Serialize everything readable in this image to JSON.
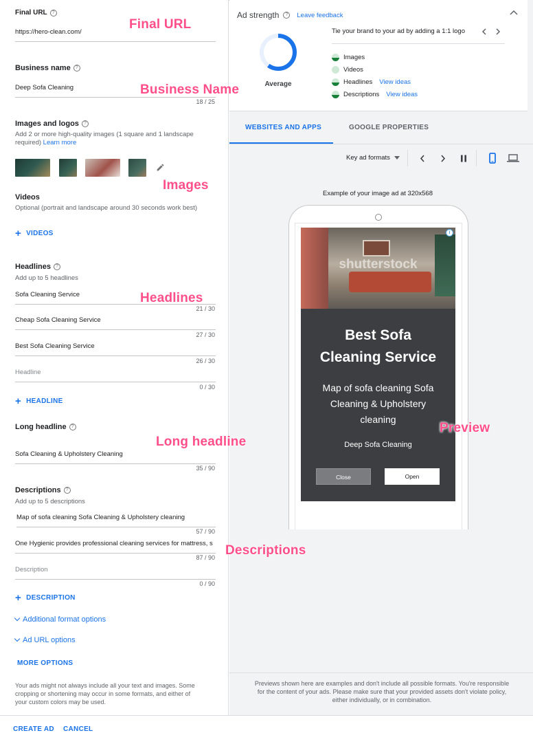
{
  "form": {
    "final_url": {
      "label": "Final URL",
      "value": "https://hero-clean.com/"
    },
    "business_name": {
      "label": "Business name",
      "value": "Deep Sofa Cleaning",
      "counter": "18 / 25"
    },
    "images": {
      "label": "Images and logos",
      "hint_line1": "Add 2 or more high-quality images (1 square and 1 landscape",
      "hint_line2": "required)",
      "learn_more": "Learn more"
    },
    "videos": {
      "label": "Videos",
      "hint": "Optional (portrait and landscape around 30 seconds work best)",
      "add_label": "VIDEOS"
    },
    "headlines": {
      "label": "Headlines",
      "hint": "Add up to 5 headlines",
      "items": [
        {
          "value": "Sofa Cleaning Service",
          "counter": "21 / 30"
        },
        {
          "value": "Cheap Sofa Cleaning Service",
          "counter": "27 / 30"
        },
        {
          "value": "Best Sofa Cleaning Service",
          "counter": "26 / 30"
        }
      ],
      "placeholder": "Headline",
      "placeholder_counter": "0 / 30",
      "add_label": "HEADLINE"
    },
    "long_headline": {
      "label": "Long headline",
      "value": "Sofa Cleaning & Upholstery Cleaning",
      "counter": "35 / 90"
    },
    "descriptions": {
      "label": "Descriptions",
      "hint": "Add up to 5 descriptions",
      "items": [
        {
          "value": "Map of sofa cleaning  Sofa Cleaning & Upholstery cleaning",
          "counter": "57 / 90"
        },
        {
          "value": "One Hygienic provides professional cleaning services for mattress, s",
          "counter": "87 / 90"
        }
      ],
      "placeholder": "Description",
      "placeholder_counter": "0 / 90",
      "add_label": "DESCRIPTION"
    },
    "additional_format": "Additional format options",
    "ad_url": "Ad URL options",
    "more_options": "MORE OPTIONS",
    "note_line1": "Your ads might not always include all your text and images. Some",
    "note_line2": "cropping or shortening may occur in some formats, and either of",
    "note_line3": "your custom colors may be used."
  },
  "actions": {
    "create": "CREATE AD",
    "cancel": "CANCEL"
  },
  "ad_strength": {
    "title": "Ad strength",
    "feedback": "Leave feedback",
    "rating": "Average",
    "tip": "Tie your brand to your ad by adding a 1:1 logo",
    "ring_fraction": 0.6,
    "items": [
      {
        "label": "Images",
        "link": "",
        "state": "half"
      },
      {
        "label": "Videos",
        "link": "",
        "state": "empty"
      },
      {
        "label": "Headlines",
        "link": "View ideas",
        "state": "half"
      },
      {
        "label": "Descriptions",
        "link": "View ideas",
        "state": "half"
      }
    ]
  },
  "preview": {
    "tabs": [
      "WEBSITES AND APPS",
      "GOOGLE PROPERTIES"
    ],
    "format_select": "Key ad formats",
    "example_caption": "Example of your image ad at 320x568",
    "watermark": "shutterstock",
    "ad_headline_line1": "Best Sofa",
    "ad_headline_line2": "Cleaning Service",
    "ad_desc_line1": "Map of sofa cleaning Sofa",
    "ad_desc_line2": "Cleaning & Upholstery",
    "ad_desc_line3": "cleaning",
    "ad_business": "Deep Sofa Cleaning",
    "btn_close": "Close",
    "btn_open": "Open",
    "footer_line1": "Previews shown here are examples and don't include all possible formats. You're responsible",
    "footer_line2": "for the content of your ads. Please make sure that your provided assets don't violate policy,",
    "footer_line3": "either individually, or in combination."
  },
  "annotations": {
    "final_url": "Final URL",
    "business_name": "Business Name",
    "images": "Images",
    "headlines": "Headlines",
    "long_headline": "Long headline",
    "descriptions": "Descriptions",
    "preview": "Preview"
  },
  "colors": {
    "accent": "#1a73e8",
    "annotation": "#ff4f8b",
    "strength_ring": "#1a73e8",
    "good": "#188038"
  }
}
